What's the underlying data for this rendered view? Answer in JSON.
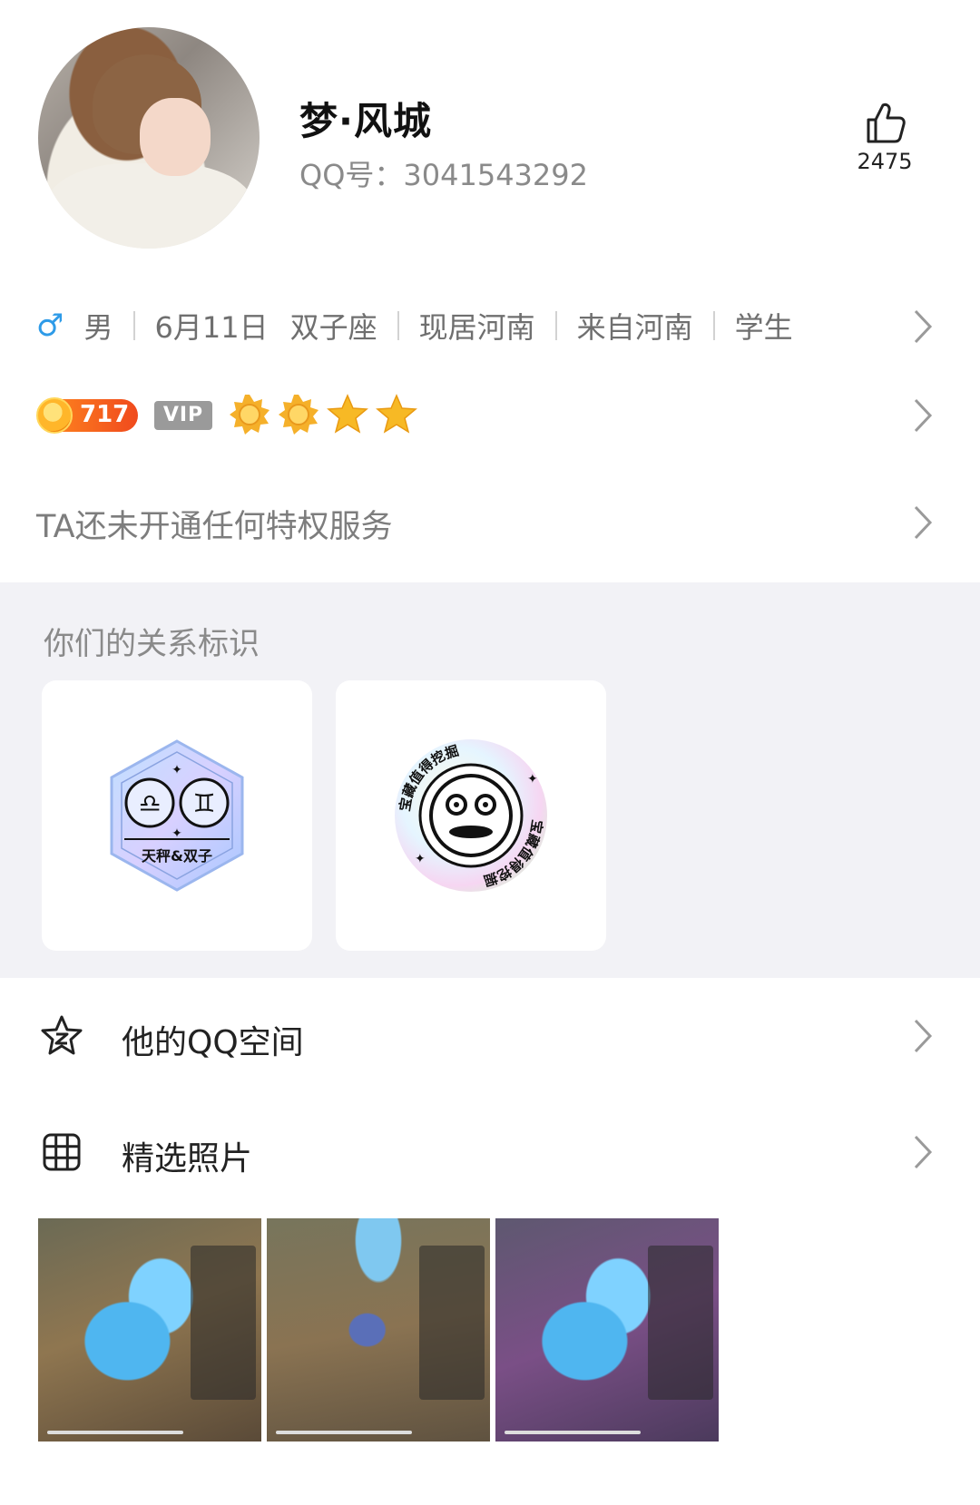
{
  "profile": {
    "name": "梦·风城",
    "qq_label": "QQ号：",
    "qq_number": "3041543292",
    "like_count": "2475"
  },
  "info": {
    "gender_symbol": "♂",
    "gender": "男",
    "birthday": "6月11日",
    "zodiac": "双子座",
    "residence": "现居河南",
    "hometown": "来自河南",
    "occupation": "学生"
  },
  "level": {
    "value": "717",
    "vip_label": "VIP",
    "medals": [
      "sun-icon",
      "sun-icon",
      "star-icon",
      "star-icon"
    ]
  },
  "privilege": {
    "text": "TA还未开通任何特权服务"
  },
  "relation": {
    "title": "你们的关系标识",
    "cards": [
      {
        "label": "天秤&双子",
        "icon": "libra-gemini-badge-icon"
      },
      {
        "label": "宝藏值得挖掘",
        "icon": "treasure-badge-icon"
      }
    ]
  },
  "list": {
    "qzone_label": "他的QQ空间",
    "photos_label": "精选照片"
  },
  "colors": {
    "accent_blue": "#2e9be8",
    "level_orange": "#f04a1d",
    "section_bg": "#f2f2f6"
  }
}
